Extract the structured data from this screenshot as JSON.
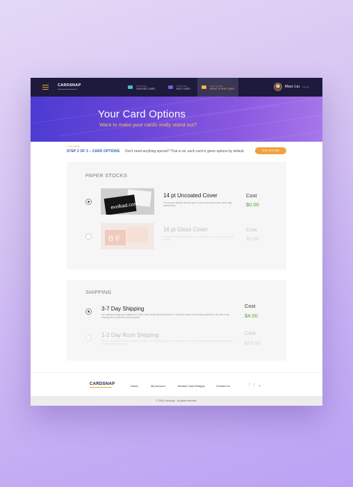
{
  "header": {
    "logo": "CARDSNAP",
    "steps": [
      {
        "small": "STEP ONE",
        "label": "CHOOSE CARD"
      },
      {
        "small": "STEP TWO",
        "label": "EDIT CARD"
      },
      {
        "small": "STEP THREE",
        "label": "PRINT & SHIP CARD"
      }
    ],
    "user_name": "Marc Liu",
    "logout": "Log out"
  },
  "hero": {
    "title": "Your Card Options",
    "subtitle": "Want to make your cards really stand out?"
  },
  "nav": {
    "back": "« GO BACK",
    "step_label": "STEP 2 OF 3 – CARD OPTIONS",
    "note": "Don't need anything special? That is ok, each card is given options by default.",
    "skip_button": "SKIP OPTIONS"
  },
  "paper_stocks": {
    "title": "PAPER STOCKS",
    "options": [
      {
        "name": "14 pt Uncoated Cover",
        "description": "You may be familiar with this type of stock from thick index cards, high quality finish.",
        "cost_label": "Cost",
        "cost": "$0.00",
        "selected": true,
        "thumb_text": "evolkad.com"
      },
      {
        "name": "16 pt Gloss Cover",
        "description": "A thicker glossy stock that gives a subtle shine to your photo-heavy card designs.",
        "cost_label": "Cost",
        "cost": "$0.00",
        "selected": false,
        "thumb_text": "B F"
      }
    ]
  },
  "shipping": {
    "title": "SHIPPING",
    "options": [
      {
        "name": "3-7 Day Shipping",
        "description": "Our standard shipping is shipped by FedEx and usually arrives between 3-7 business days not including weekends. We offer a flat shipping fee to make the process quick.",
        "cost_label": "Cost",
        "cost": "$4.00",
        "selected": true
      },
      {
        "name": "1-2 Day Rush Shipping",
        "description": "We understand the deadline is tight so we offer rush shipping to make sure cards arrive fast. Rush orders are printed first and shipped out within one business day.",
        "cost_label": "Cost",
        "cost": "$20.00",
        "selected": false
      }
    ]
  },
  "footer": {
    "logo": "CARDSNAP",
    "links": [
      "Home",
      "My Account",
      "Browse Card Designs",
      "Contact Us"
    ],
    "social": [
      "f",
      "t",
      "ig"
    ],
    "copyright": "© 2016 Cardsnap . All rights reserved."
  },
  "colors": {
    "accent": "#f0a13d",
    "nav_dark": "#1d1a3c",
    "price_green": "#4ea92f",
    "hero_start": "#4b3bd1",
    "hero_end": "#a777ea"
  }
}
